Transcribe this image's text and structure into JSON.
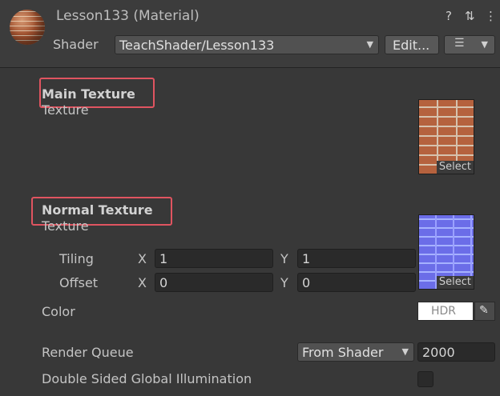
{
  "header": {
    "title": "Lesson133 (Material)",
    "help_icon": "?",
    "settings_icon": "⇅",
    "menu_icon": "⋮",
    "shader_label": "Shader",
    "shader_value": "TeachShader/Lesson133",
    "edit_label": "Edit...",
    "list_icon": "☰"
  },
  "main_texture": {
    "title": "Main Texture",
    "sub_label": "Texture",
    "select_label": "Select"
  },
  "normal_texture": {
    "title": "Normal Texture",
    "sub_label": "Texture",
    "select_label": "Select",
    "tiling_label": "Tiling",
    "offset_label": "Offset",
    "x_label": "X",
    "y_label": "Y",
    "tiling_x": "1",
    "tiling_y": "1",
    "offset_x": "0",
    "offset_y": "0"
  },
  "color": {
    "label": "Color",
    "swatch_text": "HDR",
    "picker_icon": "✎"
  },
  "render_queue": {
    "label": "Render Queue",
    "dropdown_value": "From Shader",
    "value": "2000"
  },
  "gi": {
    "label": "Double Sided Global Illumination"
  },
  "colors": {
    "highlight": "#e05460",
    "background": "#383838"
  }
}
